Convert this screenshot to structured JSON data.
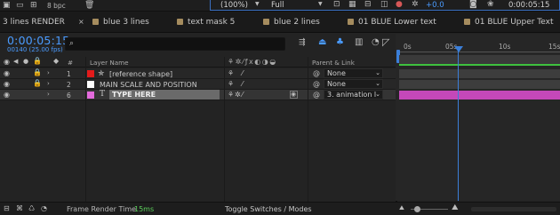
{
  "toolbar": {
    "bit_depth": "8 bpc",
    "zoom": "(100%)",
    "resolution": "Full",
    "exposure": "+0.0",
    "timecode": "0:00:05:15"
  },
  "comp_tabs": [
    {
      "label": "3 lines RENDER",
      "color": ""
    },
    {
      "label": "blue 3 lines",
      "color": "#a58c5e"
    },
    {
      "label": "text mask 5",
      "color": "#a58c5e"
    },
    {
      "label": "blue 2 lines",
      "color": "#a58c5e"
    },
    {
      "label": "01 BLUE Lower text",
      "color": "#a58c5e"
    },
    {
      "label": "01 BLUE Upper Text",
      "color": "#a58c5e"
    }
  ],
  "timeline": {
    "current_time": "0:00:05:15",
    "frame_info": "00140 (25.00 fps)",
    "search_placeholder": "",
    "columns": {
      "number": "#",
      "layer_name": "Layer Name",
      "parent_link": "Parent & Link"
    },
    "ruler_ticks": [
      "0s",
      "05s",
      "10s",
      "15s"
    ],
    "layers": [
      {
        "number": "1",
        "color": "#e31b1b",
        "type": "shape",
        "name": "[reference shape]",
        "parent": "None",
        "selected": false,
        "locked": true
      },
      {
        "number": "2",
        "color": "#ffffff",
        "type": "solid",
        "name": "MAIN SCALE AND POSITION",
        "parent": "None",
        "selected": false,
        "locked": true
      },
      {
        "number": "6",
        "color": "#e36bdc",
        "type": "text",
        "name": "TYPE HERE",
        "parent": "3. animation l",
        "selected": true,
        "locked": false
      }
    ]
  },
  "footer": {
    "render_label": "Frame Render Time",
    "render_value": "15ms",
    "toggle_label": "Toggle Switches / Modes"
  },
  "colors": {
    "accent_blue": "#4a9bff",
    "playhead": "#3b7fd9",
    "work_area_green": "#3ec13e",
    "selected_layer_bar": "#e04fd4"
  },
  "icons": [
    "folder-icon",
    "trash-icon",
    "search-icon",
    "lock-icon",
    "eye-icon",
    "audio-icon",
    "label-icon",
    "shape-icon",
    "text-layer-icon",
    "pickwhip-icon",
    "motion-blur-icon",
    "chevron-right-icon",
    "chevron-down-icon",
    "camera-icon"
  ]
}
